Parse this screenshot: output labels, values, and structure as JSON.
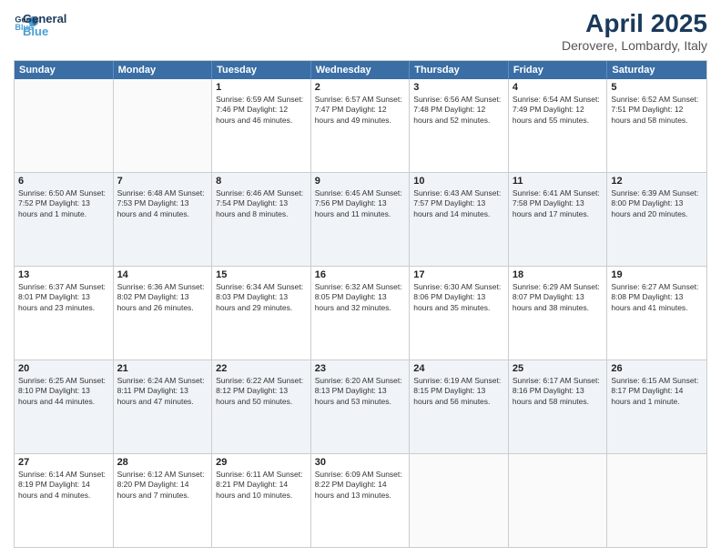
{
  "logo": {
    "line1": "General",
    "line2": "Blue"
  },
  "title": "April 2025",
  "subtitle": "Derovere, Lombardy, Italy",
  "header_days": [
    "Sunday",
    "Monday",
    "Tuesday",
    "Wednesday",
    "Thursday",
    "Friday",
    "Saturday"
  ],
  "weeks": [
    [
      {
        "day": "",
        "info": ""
      },
      {
        "day": "",
        "info": ""
      },
      {
        "day": "1",
        "info": "Sunrise: 6:59 AM\nSunset: 7:46 PM\nDaylight: 12 hours and 46 minutes."
      },
      {
        "day": "2",
        "info": "Sunrise: 6:57 AM\nSunset: 7:47 PM\nDaylight: 12 hours and 49 minutes."
      },
      {
        "day": "3",
        "info": "Sunrise: 6:56 AM\nSunset: 7:48 PM\nDaylight: 12 hours and 52 minutes."
      },
      {
        "day": "4",
        "info": "Sunrise: 6:54 AM\nSunset: 7:49 PM\nDaylight: 12 hours and 55 minutes."
      },
      {
        "day": "5",
        "info": "Sunrise: 6:52 AM\nSunset: 7:51 PM\nDaylight: 12 hours and 58 minutes."
      }
    ],
    [
      {
        "day": "6",
        "info": "Sunrise: 6:50 AM\nSunset: 7:52 PM\nDaylight: 13 hours and 1 minute."
      },
      {
        "day": "7",
        "info": "Sunrise: 6:48 AM\nSunset: 7:53 PM\nDaylight: 13 hours and 4 minutes."
      },
      {
        "day": "8",
        "info": "Sunrise: 6:46 AM\nSunset: 7:54 PM\nDaylight: 13 hours and 8 minutes."
      },
      {
        "day": "9",
        "info": "Sunrise: 6:45 AM\nSunset: 7:56 PM\nDaylight: 13 hours and 11 minutes."
      },
      {
        "day": "10",
        "info": "Sunrise: 6:43 AM\nSunset: 7:57 PM\nDaylight: 13 hours and 14 minutes."
      },
      {
        "day": "11",
        "info": "Sunrise: 6:41 AM\nSunset: 7:58 PM\nDaylight: 13 hours and 17 minutes."
      },
      {
        "day": "12",
        "info": "Sunrise: 6:39 AM\nSunset: 8:00 PM\nDaylight: 13 hours and 20 minutes."
      }
    ],
    [
      {
        "day": "13",
        "info": "Sunrise: 6:37 AM\nSunset: 8:01 PM\nDaylight: 13 hours and 23 minutes."
      },
      {
        "day": "14",
        "info": "Sunrise: 6:36 AM\nSunset: 8:02 PM\nDaylight: 13 hours and 26 minutes."
      },
      {
        "day": "15",
        "info": "Sunrise: 6:34 AM\nSunset: 8:03 PM\nDaylight: 13 hours and 29 minutes."
      },
      {
        "day": "16",
        "info": "Sunrise: 6:32 AM\nSunset: 8:05 PM\nDaylight: 13 hours and 32 minutes."
      },
      {
        "day": "17",
        "info": "Sunrise: 6:30 AM\nSunset: 8:06 PM\nDaylight: 13 hours and 35 minutes."
      },
      {
        "day": "18",
        "info": "Sunrise: 6:29 AM\nSunset: 8:07 PM\nDaylight: 13 hours and 38 minutes."
      },
      {
        "day": "19",
        "info": "Sunrise: 6:27 AM\nSunset: 8:08 PM\nDaylight: 13 hours and 41 minutes."
      }
    ],
    [
      {
        "day": "20",
        "info": "Sunrise: 6:25 AM\nSunset: 8:10 PM\nDaylight: 13 hours and 44 minutes."
      },
      {
        "day": "21",
        "info": "Sunrise: 6:24 AM\nSunset: 8:11 PM\nDaylight: 13 hours and 47 minutes."
      },
      {
        "day": "22",
        "info": "Sunrise: 6:22 AM\nSunset: 8:12 PM\nDaylight: 13 hours and 50 minutes."
      },
      {
        "day": "23",
        "info": "Sunrise: 6:20 AM\nSunset: 8:13 PM\nDaylight: 13 hours and 53 minutes."
      },
      {
        "day": "24",
        "info": "Sunrise: 6:19 AM\nSunset: 8:15 PM\nDaylight: 13 hours and 56 minutes."
      },
      {
        "day": "25",
        "info": "Sunrise: 6:17 AM\nSunset: 8:16 PM\nDaylight: 13 hours and 58 minutes."
      },
      {
        "day": "26",
        "info": "Sunrise: 6:15 AM\nSunset: 8:17 PM\nDaylight: 14 hours and 1 minute."
      }
    ],
    [
      {
        "day": "27",
        "info": "Sunrise: 6:14 AM\nSunset: 8:19 PM\nDaylight: 14 hours and 4 minutes."
      },
      {
        "day": "28",
        "info": "Sunrise: 6:12 AM\nSunset: 8:20 PM\nDaylight: 14 hours and 7 minutes."
      },
      {
        "day": "29",
        "info": "Sunrise: 6:11 AM\nSunset: 8:21 PM\nDaylight: 14 hours and 10 minutes."
      },
      {
        "day": "30",
        "info": "Sunrise: 6:09 AM\nSunset: 8:22 PM\nDaylight: 14 hours and 13 minutes."
      },
      {
        "day": "",
        "info": ""
      },
      {
        "day": "",
        "info": ""
      },
      {
        "day": "",
        "info": ""
      }
    ]
  ]
}
